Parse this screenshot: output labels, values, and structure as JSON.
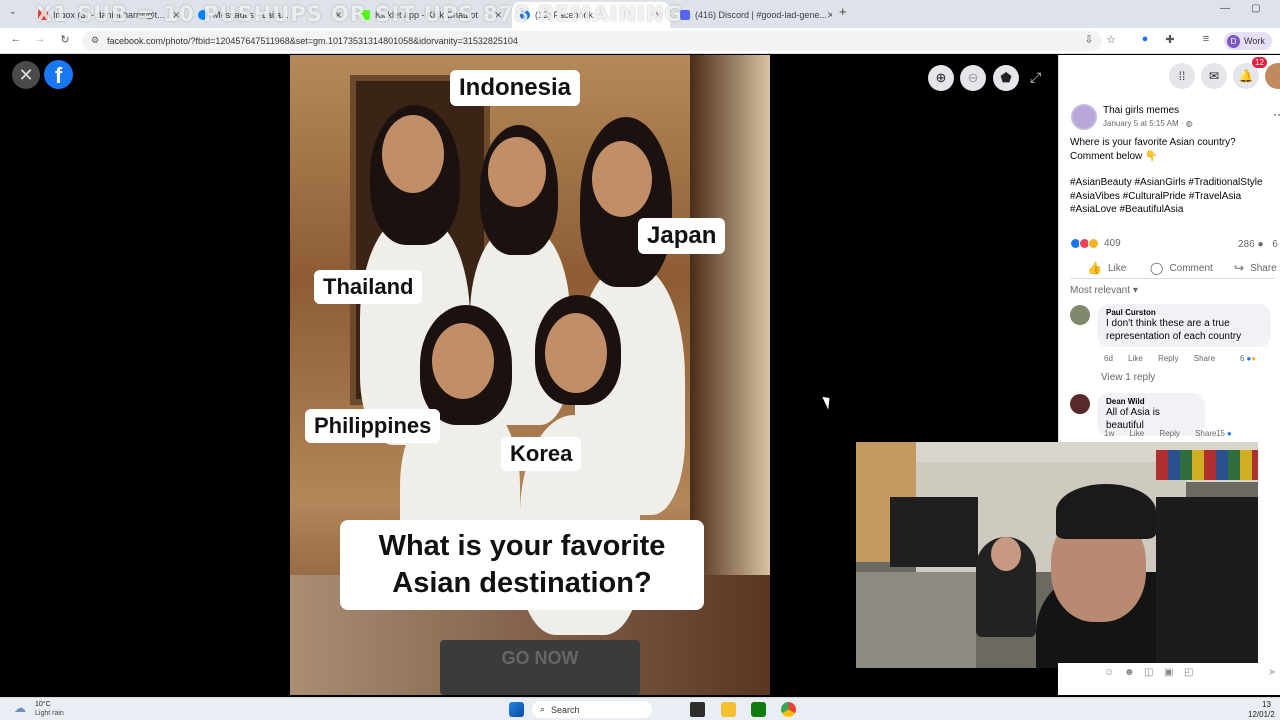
{
  "browser": {
    "tabs": [
      {
        "label": "Inbox (3) - daniel.harris@t...",
        "favicon_color": "#ea4335",
        "active": false
      },
      {
        "label": "Messages - Laila...",
        "favicon_color": "#0084ff",
        "active": false
      },
      {
        "label": "Kicklet app - Kick Chatbot",
        "favicon_color": "#53fc18",
        "active": false
      },
      {
        "label": "(13) Facebook",
        "favicon_color": "#1877f2",
        "active": true
      },
      {
        "label": "(416) Discord | #good-lad-gene...",
        "favicon_color": "#5865f2",
        "active": false
      }
    ],
    "stream_overlay": "X1 SUB = 10 PUSHUPS OR SIT UPS 878 REMAINING",
    "url": "facebook.com/photo/?fbid=120457647511968&set=gm.10173531314801058&idorvanity=31532825104",
    "profile_label": "Work",
    "profile_initial": "D"
  },
  "viewer": {
    "countries": [
      "Indonesia",
      "Japan",
      "Thailand",
      "Philippines",
      "Korea"
    ],
    "question_line1": "What is your favorite",
    "question_line2": "Asian destination?",
    "bottom_mat_text": "GO NOW"
  },
  "post": {
    "page_name": "Thai girls memes",
    "date": "January 5 at 5:15 AM · ",
    "text_line1": "Where is your favorite Asian country?",
    "text_line2": "Comment below 👇",
    "hashtags_line1": "#AsianBeauty #AsianGirls #TraditionalStyle",
    "hashtags_line2": "#AsiaVibes #CulturalPride #TravelAsia",
    "hashtags_line3": "#AsiaLove #BeautifulAsia",
    "reactions_count": "409",
    "comments_count": "286",
    "shares_count_partial": "6",
    "like_label": "Like",
    "comment_label": "Comment",
    "share_label": "Share",
    "sort_label": "Most relevant",
    "notifications_count": "12"
  },
  "comments": [
    {
      "name": "Paul Curston",
      "text_line1": "I don't think these are a true",
      "text_line2": "representation of each country",
      "age": "6d",
      "like": "Like",
      "reply": "Reply",
      "share": "Share",
      "reaction_count": "6",
      "view_replies": "View 1 reply"
    },
    {
      "name": "Dean Wild",
      "text_line1": "All of Asia is beautiful",
      "age": "1w",
      "like": "Like",
      "reply": "Reply",
      "share": "Share",
      "reaction_count": "15"
    }
  ],
  "taskbar": {
    "weather_temp": "10°C",
    "weather_desc": "Light rain",
    "search_placeholder": "Search",
    "clock_time": "13",
    "clock_date": "12/01/2"
  },
  "colors": {
    "facebook_blue": "#1877f2",
    "chrome_tabstrip": "#dee3ea",
    "notification_red": "#e41e3f"
  }
}
